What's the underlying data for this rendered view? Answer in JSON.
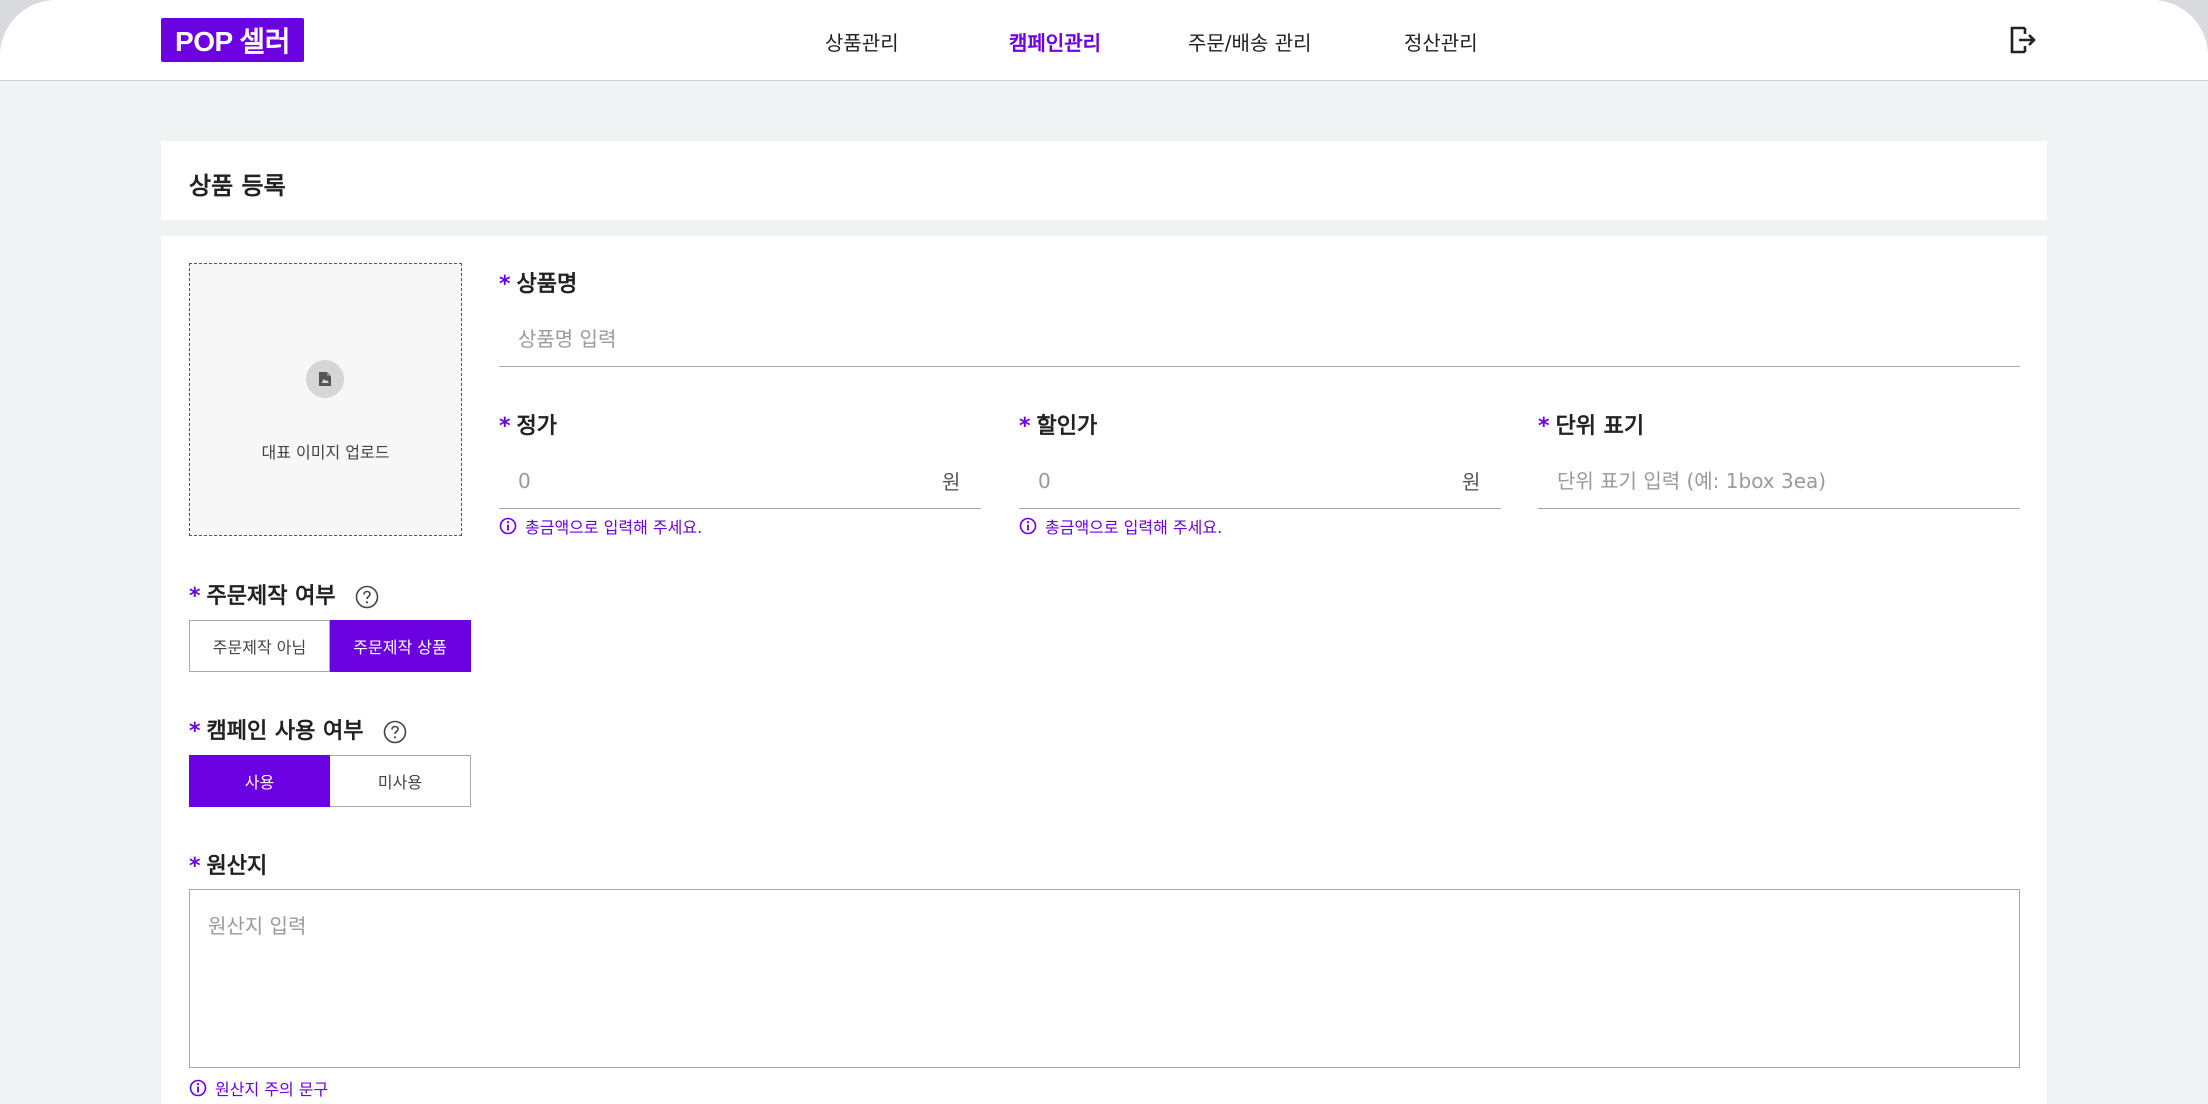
{
  "header": {
    "logo": "POP 셀러",
    "nav": [
      {
        "label": "상품관리",
        "active": false
      },
      {
        "label": "캠페인관리",
        "active": true
      },
      {
        "label": "주문/배송 관리",
        "active": false
      },
      {
        "label": "정산관리",
        "active": false
      }
    ],
    "logout_icon": "logout-icon"
  },
  "page": {
    "title": "상품 등록"
  },
  "form": {
    "image_upload_label": "대표 이미지 업로드",
    "product_name": {
      "label": "상품명",
      "required_mark": "*",
      "placeholder": "상품명 입력",
      "value": ""
    },
    "list_price": {
      "label": "정가",
      "required_mark": "*",
      "placeholder": "0",
      "unit": "원",
      "helper": "총금액으로 입력해 주세요."
    },
    "sale_price": {
      "label": "할인가",
      "required_mark": "*",
      "placeholder": "0",
      "unit": "원",
      "helper": "총금액으로 입력해 주세요."
    },
    "unit_display": {
      "label": "단위 표기",
      "required_mark": "*",
      "placeholder": "단위 표기 입력 (예: 1box 3ea)"
    },
    "custom_made": {
      "label": "주문제작 여부",
      "required_mark": "*",
      "options": [
        "주문제작 아님",
        "주문제작 상품"
      ],
      "selected": "주문제작 상품"
    },
    "campaign_use": {
      "label": "캠페인 사용 여부",
      "required_mark": "*",
      "options": [
        "사용",
        "미사용"
      ],
      "selected": "사용"
    },
    "origin": {
      "label": "원산지",
      "required_mark": "*",
      "placeholder": "원산지 입력",
      "helper": "원산지 주의 문구"
    }
  },
  "colors": {
    "accent": "#6b00e0",
    "background": "#f1f2f4",
    "card": "#ffffff",
    "border": "#a8a8a8"
  }
}
